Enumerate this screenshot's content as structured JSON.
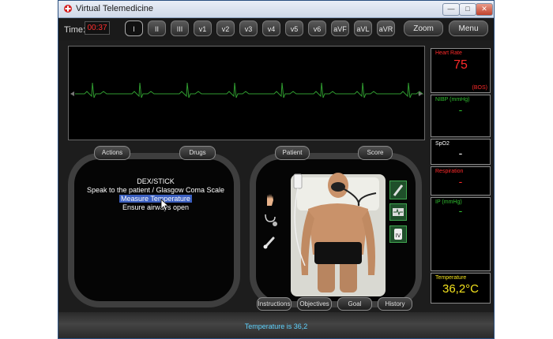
{
  "window": {
    "title": "Virtual Telemedicine"
  },
  "toolbar": {
    "time_label": "Time:",
    "time_value": "00:37",
    "leads": [
      "I",
      "II",
      "III",
      "v1",
      "v2",
      "v3",
      "v4",
      "v5",
      "v6",
      "aVF",
      "aVL",
      "aVR"
    ],
    "zoom_label": "Zoom",
    "menu_label": "Menu"
  },
  "vitals": {
    "heart_rate": {
      "label": "Heart Rate",
      "value": "75",
      "unit": "(BOS)"
    },
    "nibp": {
      "label": "NIBP (mmHg)",
      "value": "-"
    },
    "spo2": {
      "label": "SpO2",
      "value": "-"
    },
    "respiration": {
      "label": "Respiration",
      "value": "-"
    },
    "ip": {
      "label": "IP (mmHg)",
      "value": "-"
    },
    "temperature": {
      "label": "Temperature",
      "value": "36,2°C"
    }
  },
  "panels": {
    "actions_tab": "Actions",
    "drugs_tab": "Drugs",
    "patient_tab": "Patient",
    "score_tab": "Score"
  },
  "actions": {
    "items": [
      "DEX/STICK",
      "Speak to the patient / Glasgow Coma Scale",
      "Measure Temperature",
      "Ensure airways open"
    ]
  },
  "bottom_tabs": {
    "instructions": "Instructions",
    "objectives": "Objectives",
    "goal": "Goal",
    "history": "History"
  },
  "status": {
    "message": "Temperature is 36,2"
  },
  "colors": {
    "ecg_trace": "#2f9a2f",
    "heart_rate": "#ff2a2a",
    "nibp": "#30c030",
    "temperature": "#f3e21d",
    "status_text": "#5fd3ff"
  }
}
